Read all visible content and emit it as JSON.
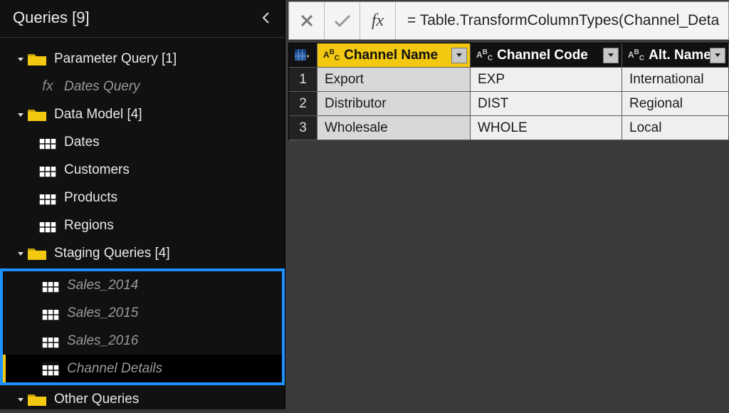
{
  "sidebar": {
    "title": "Queries [9]",
    "groups": [
      {
        "label": "Parameter Query [1]",
        "items": [
          {
            "kind": "fx",
            "label": "Dates Query",
            "dim": true
          }
        ]
      },
      {
        "label": "Data Model [4]",
        "items": [
          {
            "kind": "table",
            "label": "Dates"
          },
          {
            "kind": "table",
            "label": "Customers"
          },
          {
            "kind": "table",
            "label": "Products"
          },
          {
            "kind": "table",
            "label": "Regions"
          }
        ]
      },
      {
        "label": "Staging Queries [4]",
        "highlight": true,
        "items": [
          {
            "kind": "table",
            "label": "Sales_2014",
            "dim": true
          },
          {
            "kind": "table",
            "label": "Sales_2015",
            "dim": true
          },
          {
            "kind": "table",
            "label": "Sales_2016",
            "dim": true
          },
          {
            "kind": "table",
            "label": "Channel Details",
            "dim": true,
            "selected": true,
            "italic": true
          }
        ]
      },
      {
        "label": "Other Queries",
        "items": []
      }
    ]
  },
  "formula": "= Table.TransformColumnTypes(Channel_Deta",
  "table": {
    "columns": [
      {
        "header": "Channel Name",
        "selected": true
      },
      {
        "header": "Channel Code"
      },
      {
        "header": "Alt. Name"
      }
    ],
    "rows": [
      {
        "n": "1",
        "c": [
          "Export",
          "EXP",
          "International"
        ]
      },
      {
        "n": "2",
        "c": [
          "Distributor",
          "DIST",
          "Regional"
        ]
      },
      {
        "n": "3",
        "c": [
          "Wholesale",
          "WHOLE",
          "Local"
        ]
      }
    ]
  }
}
